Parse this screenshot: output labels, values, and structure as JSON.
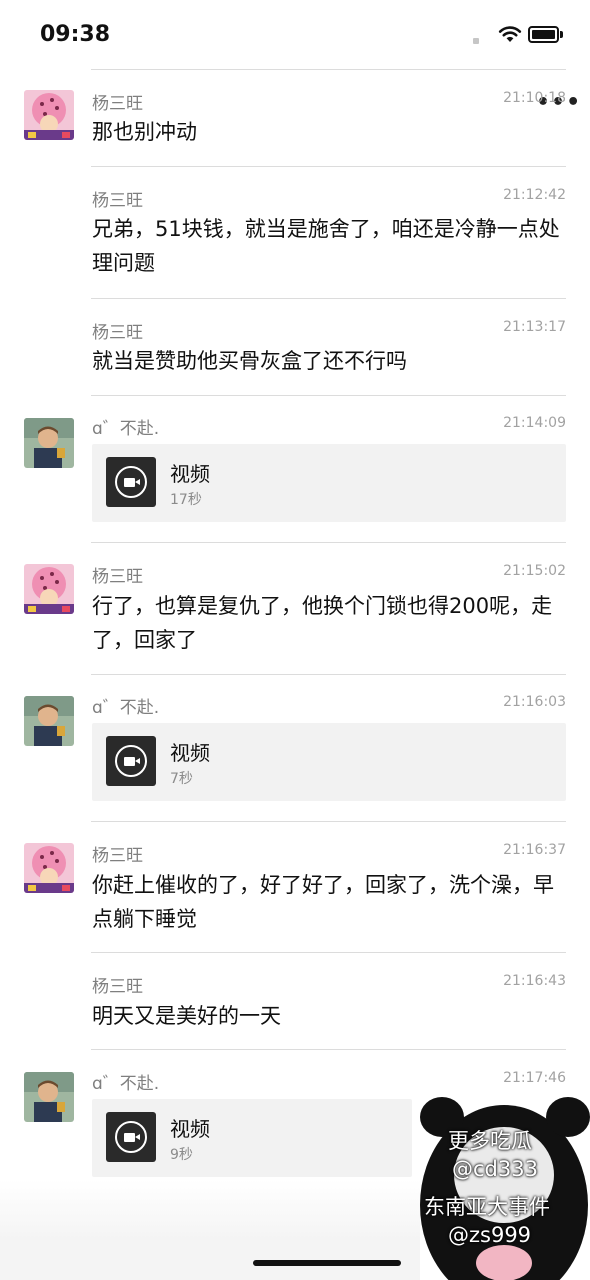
{
  "status": {
    "time": "09:38"
  },
  "messages": [
    {
      "sender": "杨三旺",
      "time": "21:10:18",
      "text": "那也别冲动"
    },
    {
      "sender": "杨三旺",
      "time": "21:12:42",
      "text": "兄弟，51块钱，就当是施舍了，咱还是冷静一点处理问题"
    },
    {
      "sender": "杨三旺",
      "time": "21:13:17",
      "text": "就当是赞助他买骨灰盒了还不行吗"
    },
    {
      "sender": "ɑ゛不赴.",
      "time": "21:14:09",
      "video": {
        "title": "视频",
        "duration": "17秒"
      }
    },
    {
      "sender": "杨三旺",
      "time": "21:15:02",
      "text": "行了，也算是复仇了，他换个门锁也得200呢，走了，回家了"
    },
    {
      "sender": "ɑ゛不赴.",
      "time": "21:16:03",
      "video": {
        "title": "视频",
        "duration": "7秒"
      }
    },
    {
      "sender": "杨三旺",
      "time": "21:16:37",
      "text": "你赶上催收的了，好了好了，回家了，洗个澡，早点躺下睡觉"
    },
    {
      "sender": "杨三旺",
      "time": "21:16:43",
      "text": "明天又是美好的一天"
    },
    {
      "sender": "ɑ゛不赴.",
      "time": "21:17:46",
      "video": {
        "title": "视频",
        "duration": "9秒"
      }
    }
  ],
  "watermark": {
    "line1": "更多吃瓜",
    "line2": "@cd333",
    "line3": "东南亚大事件",
    "line4": "@zs999"
  },
  "colors": {
    "divider": "#dcdcdc",
    "sender": "#7f7f7f",
    "time": "#a2a2a2",
    "card": "#f2f2f2"
  }
}
